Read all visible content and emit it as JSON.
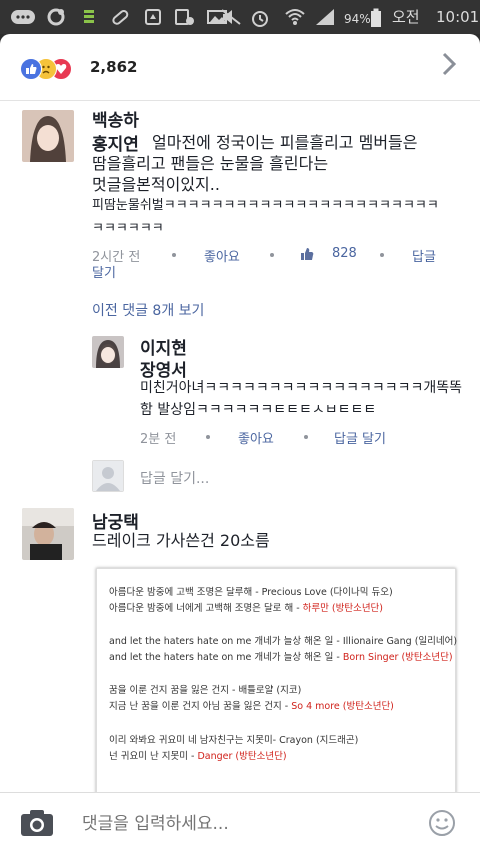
{
  "statusbar": {
    "battery_pct": "94%",
    "ampm": "오전",
    "time": "10:01"
  },
  "reactions": {
    "icons": [
      "like-icon",
      "sad-icon",
      "love-icon"
    ],
    "colors": {
      "like": "#4a73e0",
      "sad": "#f5c33b",
      "love": "#e83a53"
    },
    "count": "2,862"
  },
  "comments": [
    {
      "author": "백송하",
      "mention": "홍지연",
      "lines": [
        "얼마전에 정국이는 피를흘리고 멤버들은",
        "땀을흘리고 팬들은 눈물을 흘린다는",
        "멋글을본적이있지..",
        "피땀눈물쉬벌ㅋㅋㅋㅋㅋㅋㅋㅋㅋㅋㅋㅋㅋㅋㅋㅋㅋㅋㅋㅋㅋㅋㅋ",
        "ㅋㅋㅋㅋㅋㅋ"
      ],
      "time": "2시간 전",
      "like": "좋아요",
      "likes": "828",
      "reply": "답글",
      "reply2": "달기"
    }
  ],
  "prev_replies": "이전 댓글 8개 보기",
  "reply": {
    "author": "이지현",
    "mention": "장영서",
    "lines": [
      "미친거아녀ㅋㅋㅋㅋㅋㅋㅋㅋㅋㅋㅋㅋㅋㅋㅋㅋㅋ개똑똑",
      "함 발상임ㅋㅋㅋㅋㅋㅋㅌㅌㅌㅅㅂㅌㅌㅌ"
    ],
    "time": "2분 전",
    "like": "좋아요",
    "reply": "답글 달기"
  },
  "reply_placeholder": "답글 달기...",
  "comment2": {
    "author": "남궁택",
    "text": "드레이크 가사쓴건 20소름",
    "attachment": [
      {
        "a": "아름다운 밤중에 고백 조명은 달루해 - Precious Love (다이나믹 듀오)",
        "b": ""
      },
      {
        "a": "아름다운 밤중에 너에게 고백해 조명은 달로 해 - ",
        "b": "하루만 (방탄소년단)"
      },
      {
        "a": "",
        "b": ""
      },
      {
        "a": "and let the haters hate on me  개네가 늘상 해온 일 - Illionaire Gang (일리네어)",
        "b": ""
      },
      {
        "a": "and let the haters hate on me  개네가 늘상 해온 일 - ",
        "b": "Born Singer (방탄소년단)"
      },
      {
        "a": "",
        "b": ""
      },
      {
        "a": "꿈을 이룬 건지 꿈을 잃은 건지 - 배틀로얄 (지코)",
        "b": ""
      },
      {
        "a": "지금 난 꿈을 이룬 건지 아님 꿈을 잃은 건지 - ",
        "b": "So 4 more (방탄소년단)"
      },
      {
        "a": "",
        "b": ""
      },
      {
        "a": "이리 와봐요 귀요미 네 남자친구는 지못미- Crayon (지드래곤)",
        "b": ""
      },
      {
        "a": "넌 귀요미 난 지못미 - ",
        "b": "Danger (방탄소년단)"
      }
    ]
  },
  "composer": {
    "placeholder": "댓글을 입력하세요..."
  }
}
